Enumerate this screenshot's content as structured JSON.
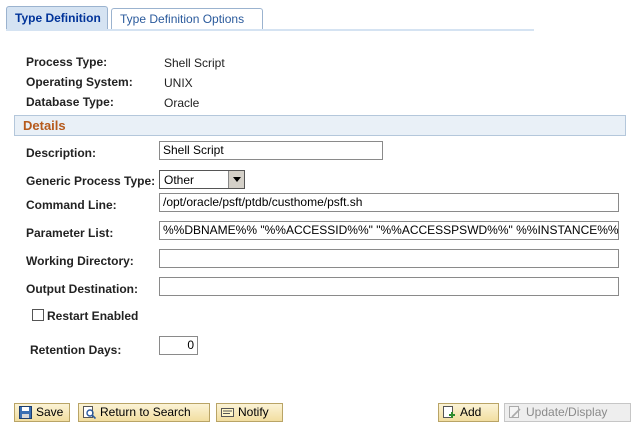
{
  "tabs": [
    {
      "label": "Type Definition",
      "active": true
    },
    {
      "label": "Type Definition Options",
      "active": false
    }
  ],
  "info": {
    "process_type_label": "Process Type:",
    "process_type_value": "Shell Script",
    "os_label": "Operating System:",
    "os_value": "UNIX",
    "db_label": "Database Type:",
    "db_value": "Oracle"
  },
  "details": {
    "section_title": "Details",
    "description_label": "Description:",
    "description_value": "Shell Script",
    "generic_type_label": "Generic Process Type:",
    "generic_type_value": "Other",
    "command_line_label": "Command Line:",
    "command_line_value": "/opt/oracle/psft/ptdb/custhome/psft.sh",
    "parameter_list_label": "Parameter List:",
    "parameter_list_value": "%%DBNAME%% \"%%ACCESSID%%\" \"%%ACCESSPSWD%%\" %%INSTANCE%%",
    "working_dir_label": "Working Directory:",
    "working_dir_value": "",
    "output_dest_label": "Output Destination:",
    "output_dest_value": "",
    "restart_label": "Restart Enabled",
    "restart_checked": false,
    "retention_label": "Retention Days:",
    "retention_value": "0"
  },
  "toolbar": {
    "save_label": "Save",
    "return_label": "Return to Search",
    "notify_label": "Notify",
    "add_label": "Add",
    "update_label": "Update/Display"
  },
  "colors": {
    "tab_active_bg": "#d5e3f2",
    "section_title": "#b65a1c",
    "button_bg": "#f2dea0"
  }
}
